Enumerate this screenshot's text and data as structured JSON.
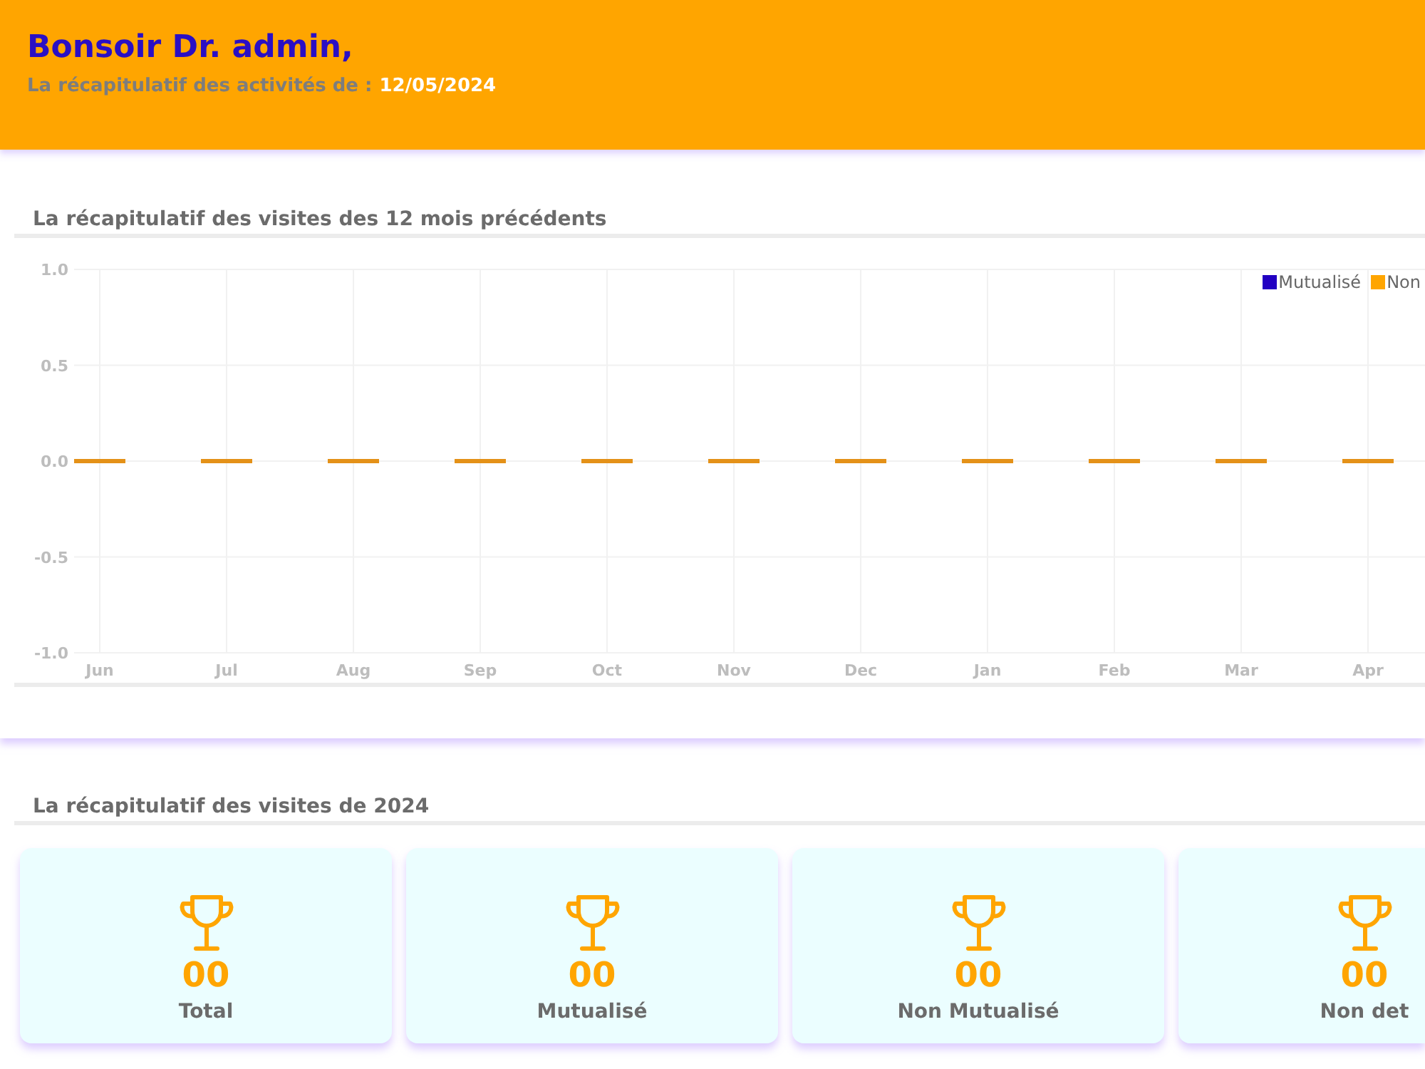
{
  "header": {
    "title": "Bonsoir Dr. admin,",
    "subtitle": "La récapitulatif des activités de :",
    "date": "12/05/2024"
  },
  "monthly": {
    "title": "La récapitulatif des visites des 12 mois précédents",
    "chart_data": {
      "type": "bar",
      "categories": [
        "Jun",
        "Jul",
        "Aug",
        "Sep",
        "Oct",
        "Nov",
        "Dec",
        "Jan",
        "Feb",
        "Mar",
        "Apr"
      ],
      "series": [
        {
          "name": "Mutualisé",
          "color": "#2200c2",
          "values": [
            0,
            0,
            0,
            0,
            0,
            0,
            0,
            0,
            0,
            0,
            0
          ]
        },
        {
          "name": "Non",
          "color": "#ffa500",
          "values": [
            0,
            0,
            0,
            0,
            0,
            0,
            0,
            0,
            0,
            0,
            0
          ]
        }
      ],
      "ylim": [
        -1,
        1
      ],
      "yticks": [
        {
          "value": -1,
          "label": "-1.0"
        },
        {
          "value": -0.5,
          "label": "-0.5"
        },
        {
          "value": 0,
          "label": "0.0"
        },
        {
          "value": 0.5,
          "label": "0.5"
        },
        {
          "value": 1,
          "label": "1.0"
        }
      ],
      "stacked": true,
      "grid": true
    }
  },
  "yearly": {
    "title": "La récapitulatif des visites de 2024",
    "cards": [
      {
        "value": "00",
        "label": "Total"
      },
      {
        "value": "00",
        "label": "Mutualisé"
      },
      {
        "value": "00",
        "label": "Non Mutualisé"
      },
      {
        "value": "00",
        "label": "Non det"
      }
    ]
  }
}
